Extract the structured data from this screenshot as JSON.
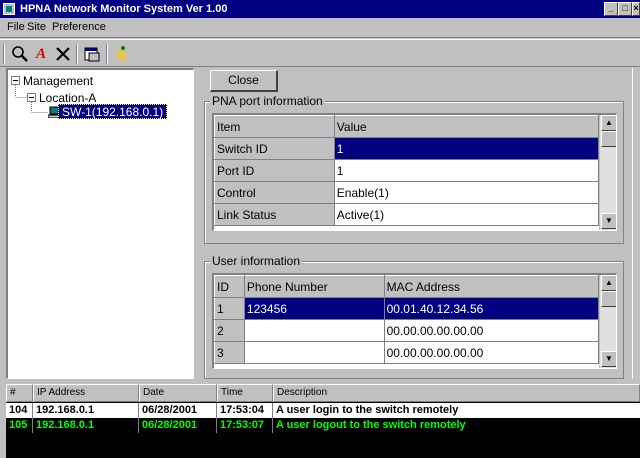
{
  "window": {
    "title": "HPNA Network Monitor System Ver 1.00",
    "min": "_",
    "max": "□",
    "close": "×"
  },
  "menu": {
    "items": [
      {
        "label": "File"
      },
      {
        "label": "Site"
      },
      {
        "label": "Preference"
      }
    ]
  },
  "toolbar": {
    "tools": [
      "magnifier-icon",
      "font-a-icon",
      "delete-x-icon",
      "properties-icon",
      "running-man-icon"
    ]
  },
  "tree": {
    "root": "Management",
    "location": "Location-A",
    "switch": "SW-1(192.168.0.1)"
  },
  "close_button": "Close",
  "port_info": {
    "title": "PNA port information",
    "headers": [
      "Item",
      "Value"
    ],
    "rows": [
      [
        "Switch ID",
        "1"
      ],
      [
        "Port ID",
        "1"
      ],
      [
        "Control",
        "Enable(1)"
      ],
      [
        "Link Status",
        "Active(1)"
      ]
    ],
    "selected_row": 0
  },
  "user_info": {
    "title": "User information",
    "headers": [
      "ID",
      "Phone Number",
      "MAC Address"
    ],
    "rows": [
      [
        "1",
        "123456",
        "00.01.40.12.34.56"
      ],
      [
        "2",
        "",
        "00.00.00.00.00.00"
      ],
      [
        "3",
        "",
        "00.00.00.00.00.00"
      ]
    ],
    "selected_row": 0
  },
  "log": {
    "headers": [
      "#",
      "IP Address",
      "Date",
      "Time",
      "Description"
    ],
    "rows": [
      [
        "104",
        "192.168.0.1",
        "06/28/2001",
        "17:53:04",
        "A user login to the switch remotely"
      ],
      [
        "105",
        "192.168.0.1",
        "06/28/2001",
        "17:53:07",
        "A user logout to the switch remotely"
      ]
    ]
  },
  "colors": {
    "title_bg": "#000080",
    "selection": "#000080",
    "log_highlight": "#00ff00",
    "log_bg": "#000000"
  }
}
